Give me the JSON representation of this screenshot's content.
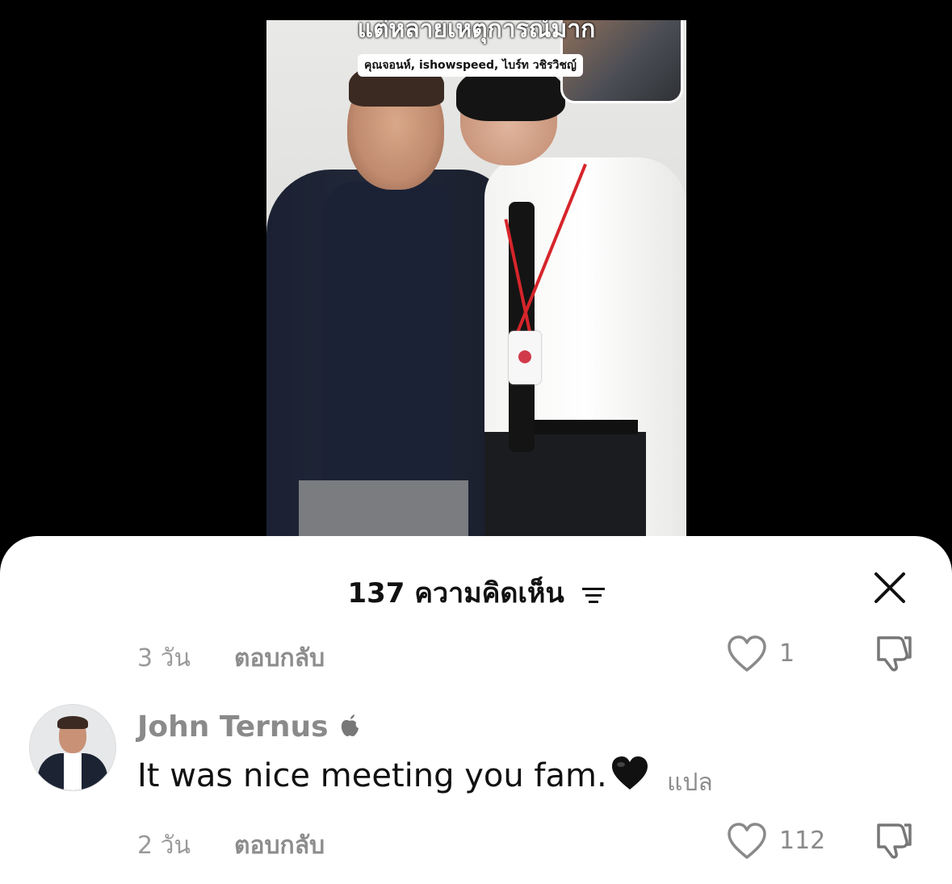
{
  "video": {
    "caption_title": "แต่หลายเหตุการณ์มาก",
    "caption_tag": "คุณจอนห์, ishowspeed, ไบร์ท วชิรวิชญ์"
  },
  "comments_sheet": {
    "count": "137",
    "title_suffix": "ความคิดเห็น",
    "comments": [
      {
        "time": "3 วัน",
        "reply_label": "ตอบกลับ",
        "likes": "1"
      },
      {
        "username": "John Ternus",
        "verified_icon": "apple-logo-icon",
        "text": "It was nice meeting you fam.",
        "emoji": "black-heart",
        "translate_label": "แปล",
        "time": "2 วัน",
        "reply_label": "ตอบกลับ",
        "likes": "112"
      }
    ]
  },
  "colors": {
    "background": "#000000",
    "sheet": "#ffffff",
    "muted_text": "#8d8d8d",
    "primary_text": "#111111"
  }
}
